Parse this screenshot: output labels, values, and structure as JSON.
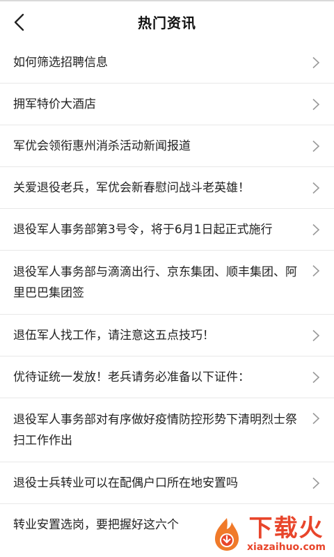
{
  "header": {
    "title": "热门资讯",
    "back_icon": "chevron-left-icon"
  },
  "news": [
    {
      "title": "如何筛选招聘信息"
    },
    {
      "title": "拥军特价大酒店"
    },
    {
      "title": "军优会领衔惠州消杀活动新闻报道"
    },
    {
      "title": "关爱退役老兵，军优会新春慰问战斗老英雄！"
    },
    {
      "title": "退役军人事务部第3号令，将于6月1日起正式施行"
    },
    {
      "title": "退役军人事务部与滴滴出行、京东集团、顺丰集团、阿里巴巴集团签"
    },
    {
      "title": "退伍军人找工作，请注意这五点技巧！"
    },
    {
      "title": "优待证统一发放！老兵请务必准备以下证件："
    },
    {
      "title": "退役军人事务部对有序做好疫情防控形势下清明烈士祭扫工作作出"
    },
    {
      "title": "退役士兵转业可以在配偶户口所在地安置吗"
    },
    {
      "title": "转业安置选岗，要把握好这六个"
    }
  ],
  "watermark": {
    "brand": "下载火",
    "url": "xiazaihuo.com",
    "accent": "#e8452b"
  }
}
